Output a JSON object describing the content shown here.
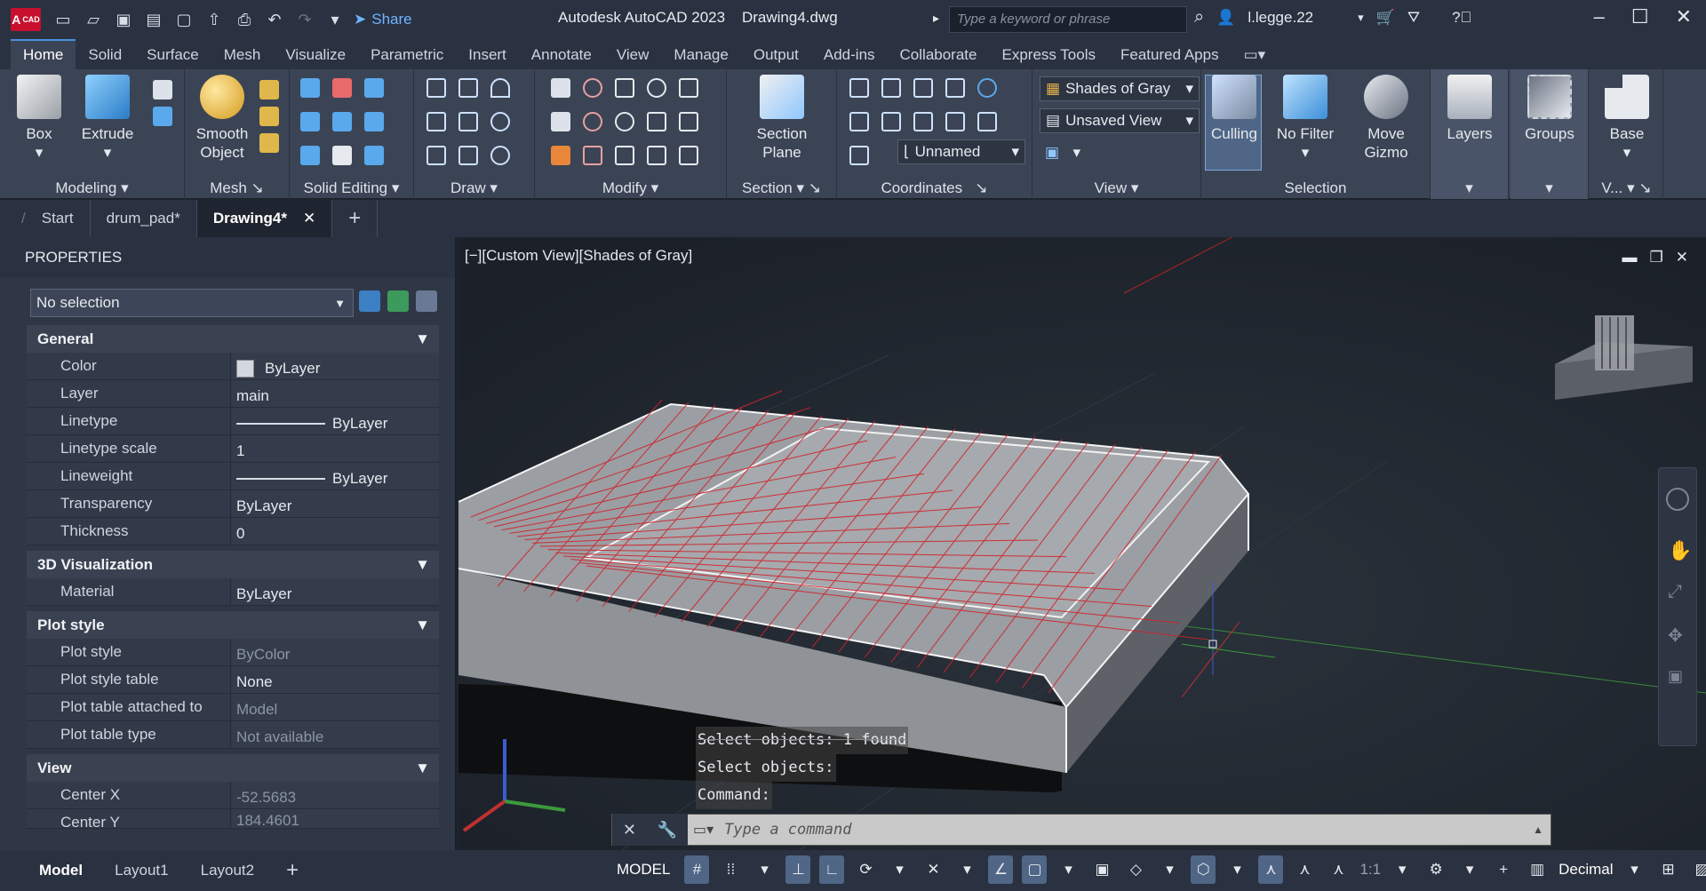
{
  "titlebar": {
    "logo": "A",
    "logo_sub": "CAD",
    "share_label": "Share",
    "app_name": "Autodesk AutoCAD 2023",
    "file_name": "Drawing4.dwg",
    "search_placeholder": "Type a keyword or phrase",
    "user": "l.legge.22"
  },
  "ribbon_tabs": [
    "Home",
    "Solid",
    "Surface",
    "Mesh",
    "Visualize",
    "Parametric",
    "Insert",
    "Annotate",
    "View",
    "Manage",
    "Output",
    "Add-ins",
    "Collaborate",
    "Express Tools",
    "Featured Apps"
  ],
  "ribbon": {
    "box": "Box",
    "extrude": "Extrude",
    "smooth_object": [
      "Smooth",
      "Object"
    ],
    "section_plane": [
      "Section",
      "Plane"
    ],
    "visual_style": "Shades of Gray",
    "saved_view": "Unsaved View",
    "ucs_name": "Unnamed",
    "culling": "Culling",
    "no_filter": "No Filter",
    "move_gizmo": [
      "Move",
      "Gizmo"
    ],
    "layers": "Layers",
    "groups": "Groups",
    "base": "Base",
    "panel_titles": {
      "modeling": "Modeling",
      "mesh": "Mesh",
      "solid_editing": "Solid Editing",
      "draw": "Draw",
      "modify": "Modify",
      "section": "Section",
      "coordinates": "Coordinates",
      "view": "View",
      "selection": "Selection",
      "v": "V..."
    }
  },
  "file_tabs": [
    "Start",
    "drum_pad*",
    "Drawing4*"
  ],
  "properties": {
    "title": "PROPERTIES",
    "selection": "No selection",
    "sections": {
      "general": "General",
      "viz": "3D Visualization",
      "plot": "Plot style",
      "view": "View"
    },
    "general": [
      {
        "k": "Color",
        "v": "ByLayer"
      },
      {
        "k": "Layer",
        "v": "main"
      },
      {
        "k": "Linetype",
        "v": "ByLayer"
      },
      {
        "k": "Linetype scale",
        "v": "1"
      },
      {
        "k": "Lineweight",
        "v": "ByLayer"
      },
      {
        "k": "Transparency",
        "v": "ByLayer"
      },
      {
        "k": "Thickness",
        "v": "0"
      }
    ],
    "viz": [
      {
        "k": "Material",
        "v": "ByLayer"
      }
    ],
    "plot": [
      {
        "k": "Plot style",
        "v": "ByColor"
      },
      {
        "k": "Plot style table",
        "v": "None"
      },
      {
        "k": "Plot table attached to",
        "v": "Model"
      },
      {
        "k": "Plot table type",
        "v": "Not available"
      }
    ],
    "view": [
      {
        "k": "Center X",
        "v": "-52.5683"
      },
      {
        "k": "Center Y",
        "v": "184.4601"
      }
    ]
  },
  "viewport": {
    "label": "[−][Custom View][Shades of Gray]",
    "cmd_history": [
      "Select objects: 1 found",
      "Select objects:",
      "Command:"
    ],
    "cmd_placeholder": "Type a command",
    "axis_x": "X",
    "axis_y": "Y",
    "axis_z": "Z"
  },
  "statusbar": {
    "layouts": [
      "Model",
      "Layout1",
      "Layout2"
    ],
    "model": "MODEL",
    "scale": "1:1",
    "units": "Decimal"
  },
  "colors": {
    "accent": "#4a90e2",
    "wire_red": "#d0222a",
    "logo_red": "#c8102e"
  }
}
